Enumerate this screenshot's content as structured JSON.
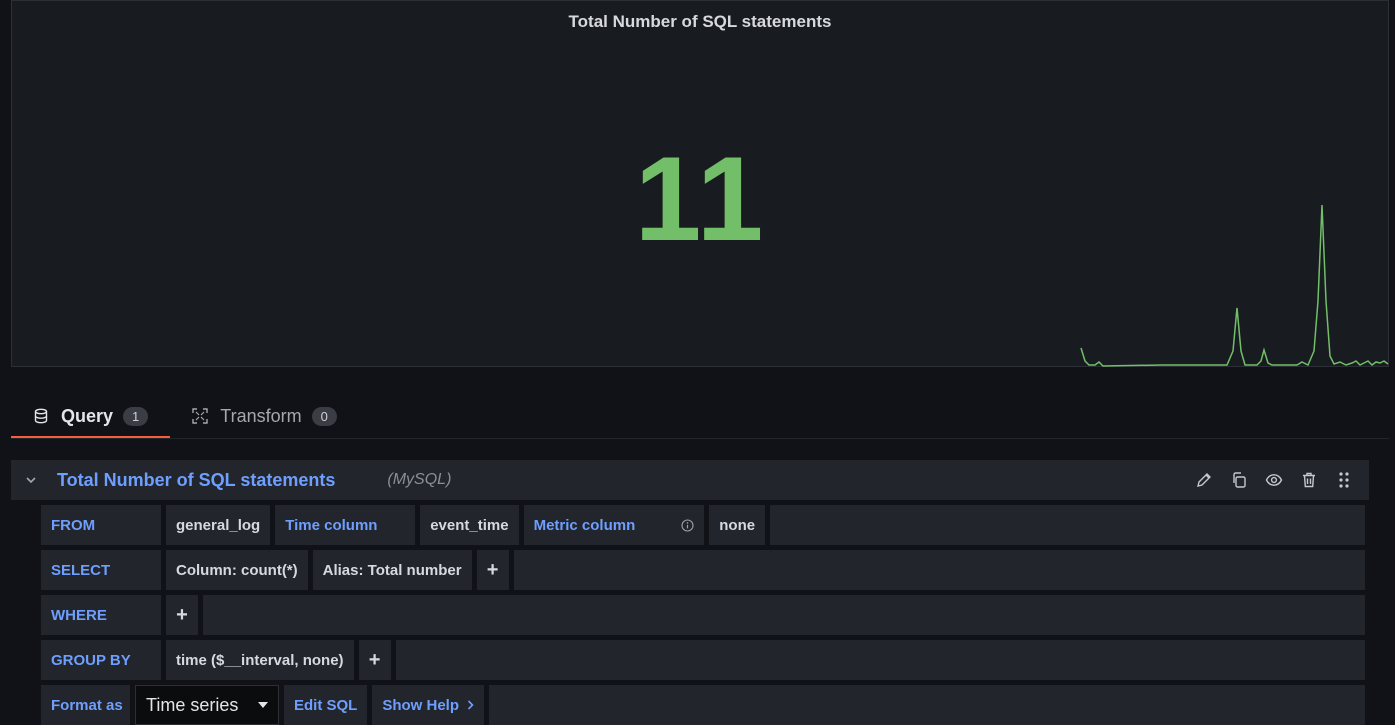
{
  "panel": {
    "title": "Total Number of SQL statements",
    "stat_value": "11",
    "accent": "#73bf69"
  },
  "tabs": [
    {
      "label": "Query",
      "count": "1",
      "icon": "database-icon"
    },
    {
      "label": "Transform",
      "count": "0",
      "icon": "transform-icon"
    }
  ],
  "query": {
    "name": "Total Number of SQL statements",
    "datasource": "(MySQL)",
    "from": {
      "keyword": "FROM",
      "table": "general_log",
      "time_label": "Time column",
      "time_value": "event_time",
      "metric_label": "Metric column",
      "metric_value": "none"
    },
    "select": {
      "keyword": "SELECT",
      "column": "Column: count(*)",
      "alias": "Alias: Total number",
      "add": "+"
    },
    "where": {
      "keyword": "WHERE",
      "add": "+"
    },
    "group_by": {
      "keyword": "GROUP BY",
      "value": "time ($__interval, none)",
      "add": "+"
    },
    "format": {
      "keyword": "Format as",
      "selected": "Time series",
      "edit_sql": "Edit SQL",
      "show_help": "Show Help"
    }
  },
  "colors": {
    "link_blue": "#6e9fff",
    "active_tab": "#f55f3e",
    "background": "#111217",
    "panel_bg": "#181b1f"
  }
}
